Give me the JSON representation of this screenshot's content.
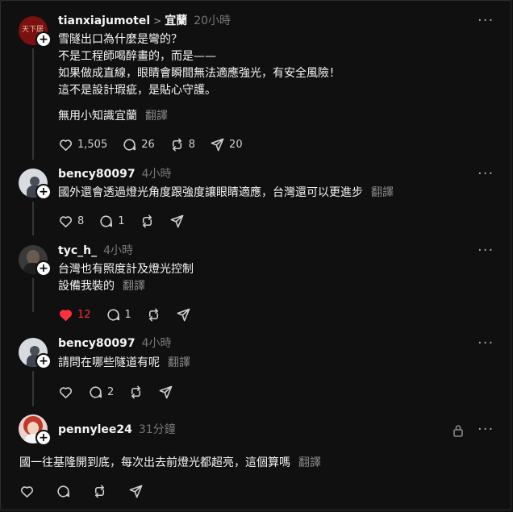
{
  "posts": [
    {
      "username": "tianxiajumotel",
      "location": "宜蘭",
      "time": "20小時",
      "lines": [
        "雪隧出口為什麼是彎的？",
        "不是工程師喝醉畫的，而是——",
        "如果做成直線，眼睛會瞬間無法適應強光，有安全風險！",
        "這不是設計瑕疵，是貼心守護。"
      ],
      "extra_text": "無用小知識宜蘭",
      "translate": "翻譯",
      "likes": "1,505",
      "comments": "26",
      "reposts": "8",
      "shares": "20",
      "avatar_text": "天下居"
    },
    {
      "username": "bency80097",
      "time": "4小時",
      "lines": [
        "國外還會透過燈光角度跟強度讓眼睛適應，台灣還可以更進步"
      ],
      "translate": "翻譯",
      "likes": "8",
      "comments": "1"
    },
    {
      "username": "tyc_h_",
      "time": "4小時",
      "lines": [
        "台灣也有照度計及燈光控制",
        "設備我裝的"
      ],
      "translate": "翻譯",
      "likes": "12",
      "comments": "1"
    },
    {
      "username": "bency80097",
      "time": "4小時",
      "lines": [
        "請問在哪些隧道有呢"
      ],
      "translate": "翻譯",
      "comments": "2"
    },
    {
      "username": "pennylee24",
      "time": "31分鐘",
      "lines": [
        "國一往基隆開到底，每次出去前燈光都超亮，這個算嗎"
      ],
      "translate": "翻譯"
    }
  ],
  "colors": {
    "background": "#101010",
    "like_active": "#ff3040",
    "muted": "#777777"
  }
}
